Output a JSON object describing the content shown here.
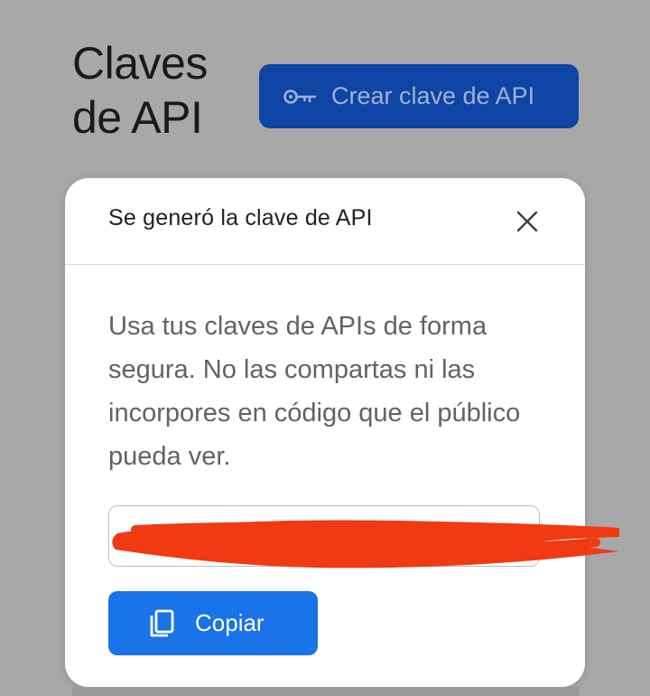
{
  "page": {
    "title": "Claves de API",
    "create_button": {
      "label": "Crear clave de API",
      "icon": "key-icon"
    }
  },
  "dialog": {
    "title": "Se generó la clave de API",
    "close_icon": "close-icon",
    "message": "Usa tus claves de APIs de forma segura. No las compartas ni las incorpores en código que el público pueda ver.",
    "key_field": {
      "value": ""
    },
    "copy_button": {
      "label": "Copiar",
      "icon": "copy-icon"
    }
  },
  "colors": {
    "backdrop": "#a8a8a8",
    "primary_button": "#1a73e8",
    "dimmed_button": "#0e45a4",
    "redaction": "#f03a12"
  }
}
